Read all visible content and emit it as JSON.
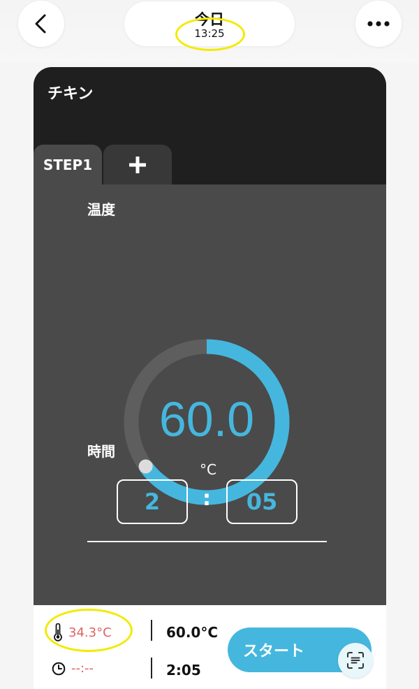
{
  "header": {
    "title": "今日",
    "time": "13:25",
    "back_icon": "chevron-left-icon",
    "more_icon": "more-horizontal-icon"
  },
  "recipe": {
    "title": "チキン",
    "tabs": [
      {
        "label": "STEP1",
        "selected": true
      },
      {
        "label": "+",
        "icon": "plus-icon"
      }
    ]
  },
  "temperature": {
    "label": "温度",
    "value": "60.0",
    "unit": "°C",
    "progress_fraction": 0.65
  },
  "time_setting": {
    "label": "時間",
    "hours": "2",
    "separator": ":",
    "minutes": "05"
  },
  "status": {
    "current_temp": "34.3°C",
    "current_time": "--:--",
    "target_temp": "60.0°C",
    "target_time": "2:05",
    "thermometer_icon": "thermometer-icon",
    "clock_icon": "clock-icon"
  },
  "actions": {
    "start_label": "スタート",
    "scan_icon": "scan-text-icon"
  },
  "colors": {
    "accent": "#45b7de",
    "alert": "#e06262",
    "highlight": "#f3ea00",
    "panel": "#4a4a4a",
    "card": "#1f1f1f"
  }
}
